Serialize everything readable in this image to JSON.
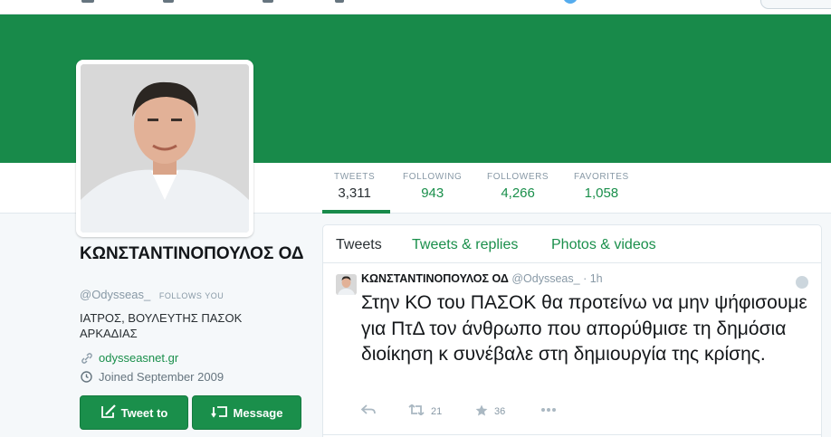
{
  "colors": {
    "brand": "#188a4a",
    "link": "#1a8f4b",
    "muted": "#8899a6",
    "text": "#292f33",
    "twitter_blue": "#55acee"
  },
  "profile": {
    "name": "ΚΩΝΣΤΑΝΤΙΝΟΠΟΥΛΟΣ ΟΔ",
    "screen_name": "@Odysseas_",
    "follows_you": "FOLLOWS YOU",
    "bio": "ΙΑΤΡΟΣ, ΒΟΥΛΕΥΤΗΣ ΠΑΣΟΚ ΑΡΚΑΔΙΑΣ",
    "website": "odysseasnet.gr",
    "joined": "Joined September 2009",
    "tweet_to_label": "Tweet to",
    "message_label": "Message"
  },
  "stats": [
    {
      "label": "TWEETS",
      "value": "3,311"
    },
    {
      "label": "FOLLOWING",
      "value": "943"
    },
    {
      "label": "FOLLOWERS",
      "value": "4,266"
    },
    {
      "label": "FAVORITES",
      "value": "1,058"
    }
  ],
  "tabs": [
    "Tweets",
    "Tweets & replies",
    "Photos & videos"
  ],
  "tweet": {
    "fullname": "ΚΩΝΣΤΑΝΤΙΝΟΠΟΥΛΟΣ ΟΔ",
    "screen_name": "@Odysseas_",
    "separator": "·",
    "time": "1h",
    "text": "Στην ΚΟ του ΠΑΣΟΚ θα προτείνω να μην ψήφισουμε για ΠτΔ τον άνθρωπο που απορύθμισε τη δημόσια διοίκηση κ συνέβαλε στη δημιουργία της κρίσης.",
    "retweets": "21",
    "favorites": "36"
  },
  "icons": {
    "link": "link-icon",
    "calendar": "clock-icon",
    "tweet_to": "compose-icon",
    "message": "message-icon",
    "reply": "reply-icon",
    "retweet": "retweet-icon",
    "favorite": "star-icon",
    "more": "more-icon",
    "settings": "gear-icon"
  }
}
